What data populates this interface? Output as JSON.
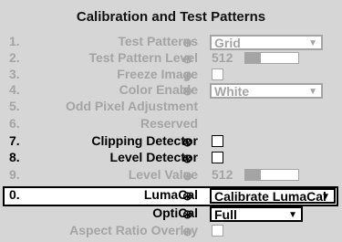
{
  "title": "Calibration and Test Patterns",
  "colors": {
    "panel": "#d6d6d6",
    "disabled_text": "#a4a4a4",
    "active_text": "#000000",
    "selected_row": "#ffffff"
  },
  "rows": [
    {
      "num": "1.",
      "label": "Test Patterns",
      "control": "dropdown",
      "value": "Grid",
      "enabled": false
    },
    {
      "num": "2.",
      "label": "Test Pattern Level",
      "control": "level",
      "value": "512",
      "level_fraction": 0.3,
      "enabled": false
    },
    {
      "num": "3.",
      "label": "Freeze Image",
      "control": "checkbox",
      "checked": false,
      "enabled": false
    },
    {
      "num": "4.",
      "label": "Color Enable",
      "control": "dropdown",
      "value": "White",
      "enabled": false
    },
    {
      "num": "5.",
      "label": "Odd Pixel Adjustment",
      "control": "none",
      "enabled": false
    },
    {
      "num": "6.",
      "label": "Reserved",
      "control": "none",
      "enabled": false
    },
    {
      "num": "7.",
      "label": "Clipping Detector",
      "control": "checkbox",
      "checked": false,
      "enabled": true
    },
    {
      "num": "8.",
      "label": "Level Detector",
      "control": "checkbox",
      "checked": false,
      "enabled": true
    },
    {
      "num": "9.",
      "label": "Level Value",
      "control": "level",
      "value": "512",
      "level_fraction": 0.3,
      "enabled": false
    },
    {
      "num": "0.",
      "label": "LumaCal",
      "control": "dropdown",
      "value": "Calibrate LumaCal",
      "enabled": true,
      "selected": true
    },
    {
      "num": "",
      "label": "OptiCal",
      "control": "dropdown",
      "value": "Full",
      "enabled": true
    },
    {
      "num": "",
      "label": "Aspect Ratio Overlay",
      "control": "checkbox",
      "checked": false,
      "enabled": false
    }
  ],
  "icons": {
    "knob": "knob-icon",
    "arrow": "triangle-down-icon"
  }
}
